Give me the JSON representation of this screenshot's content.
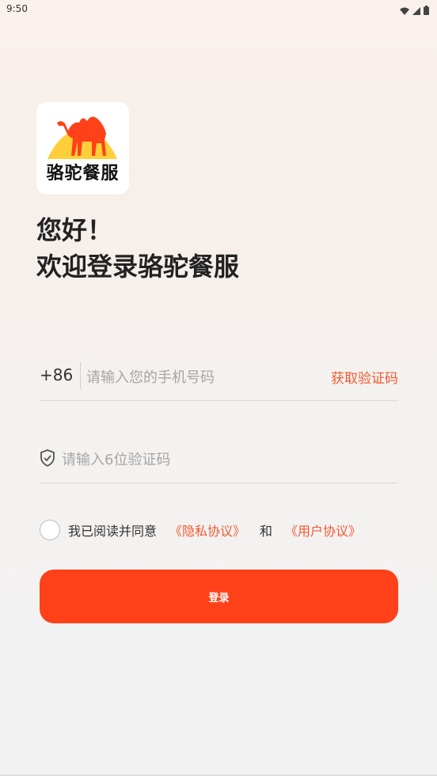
{
  "status_bar": {
    "time": "9:50",
    "icons": [
      "wifi-icon",
      "signal-icon",
      "battery-icon"
    ]
  },
  "logo": {
    "brand_text": "骆驼餐服"
  },
  "greeting": {
    "line1": "您好！",
    "line2": "欢迎登录骆驼餐服"
  },
  "phone_input": {
    "prefix": "+86",
    "placeholder": "请输入您的手机号码",
    "get_code_label": "获取验证码"
  },
  "code_input": {
    "icon": "shield-check-icon",
    "placeholder": "请输入6位验证码"
  },
  "agreement": {
    "prefix_text": "我已阅读并同意",
    "privacy_link": "《隐私协议》",
    "and_text": "和",
    "user_link": "《用户协议》"
  },
  "login_button": {
    "label": "登录"
  },
  "colors": {
    "accent": "#ff4119",
    "link": "#f05a32"
  }
}
